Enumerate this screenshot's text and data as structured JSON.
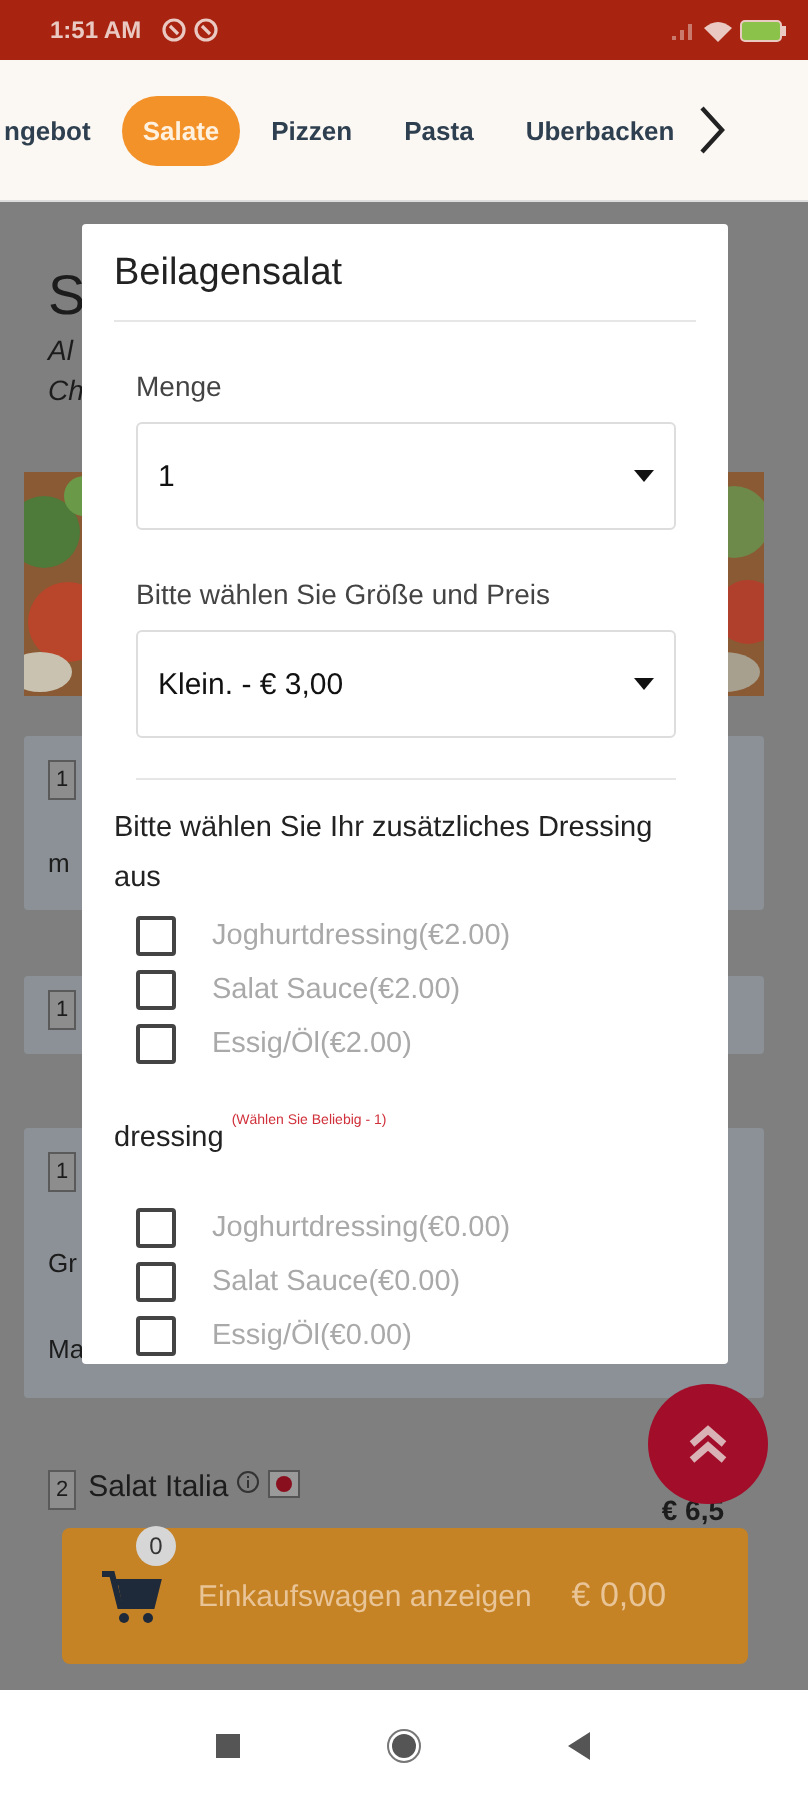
{
  "status_bar": {
    "time": "1:51 AM"
  },
  "category_tabs": [
    {
      "label": "ngebot",
      "selected": false
    },
    {
      "label": "Salate",
      "selected": true
    },
    {
      "label": "Pizzen",
      "selected": false
    },
    {
      "label": "Pasta",
      "selected": false
    },
    {
      "label": "Uberbacken",
      "selected": false
    }
  ],
  "menu_page": {
    "heading": "S",
    "description": [
      "Al",
      "Ch"
    ],
    "cards": [
      {
        "number": "1",
        "lines": [
          "m"
        ]
      },
      {
        "number": "1"
      },
      {
        "number": "1",
        "lines": [
          "Gr",
          "Ma"
        ]
      }
    ],
    "item": {
      "number": "2",
      "name": "Salat Italia",
      "price": "€ 6,5"
    }
  },
  "modal": {
    "title": "Beilagensalat",
    "fields": [
      {
        "label": "Menge",
        "value": "1"
      },
      {
        "label": "Bitte wählen Sie Größe und Preis",
        "value": "Klein. - € 3,00"
      }
    ],
    "groups": [
      {
        "title": "Bitte wählen Sie Ihr zusätzliches Dressing aus",
        "options": [
          {
            "label": "Joghurtdressing(€2.00)",
            "checked": false
          },
          {
            "label": "Salat Sauce(€2.00)",
            "checked": false
          },
          {
            "label": "Essig/Öl(€2.00)",
            "checked": false
          }
        ]
      },
      {
        "title": "dressing",
        "hint": "(Wählen Sie Beliebig - 1)",
        "options": [
          {
            "label": "Joghurtdressing(€0.00)",
            "checked": false
          },
          {
            "label": "Salat Sauce(€0.00)",
            "checked": false
          },
          {
            "label": "Essig/Öl(€0.00)",
            "checked": false
          }
        ]
      }
    ]
  },
  "cart": {
    "count": "0",
    "label": "Einkaufswagen anzeigen",
    "total": "€ 0,00"
  }
}
